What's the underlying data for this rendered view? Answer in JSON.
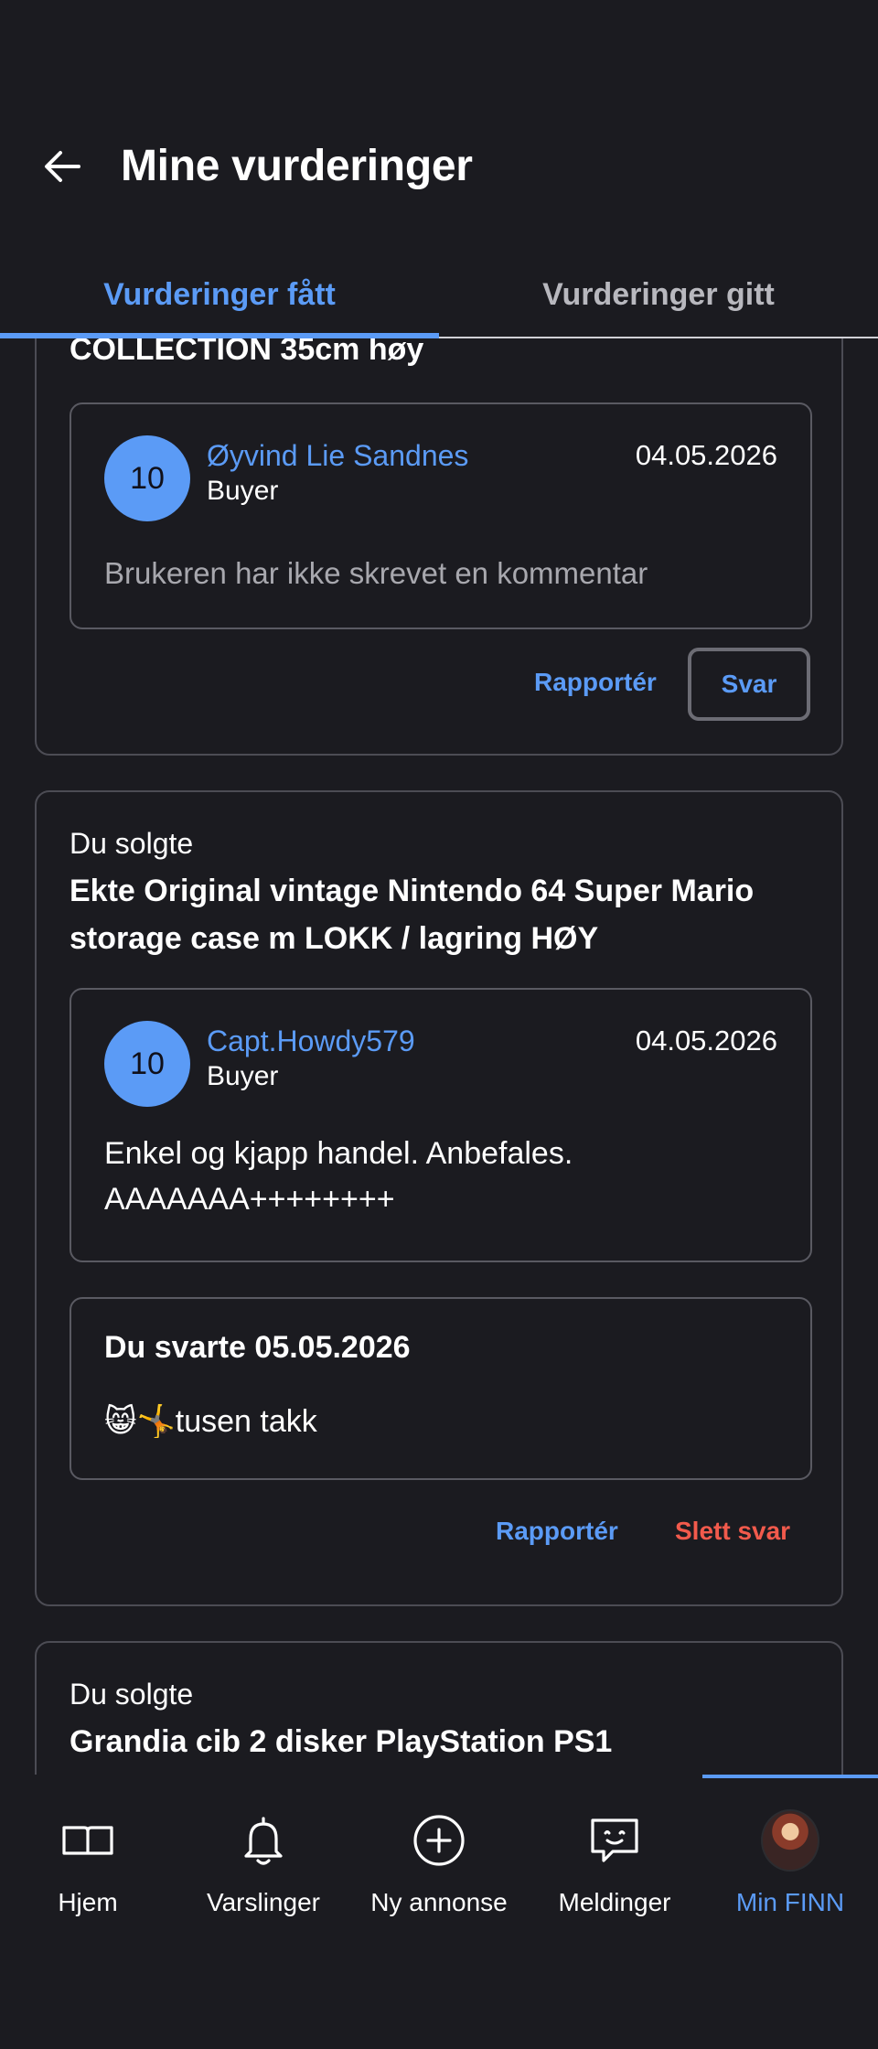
{
  "header": {
    "title": "Mine vurderinger"
  },
  "tabs": [
    {
      "label": "Vurderinger fått",
      "active": true
    },
    {
      "label": "Vurderinger gitt",
      "active": false
    }
  ],
  "reviews": [
    {
      "product_title": "COLLECTION 35cm høy",
      "score": "10",
      "reviewer": "Øyvind Lie Sandnes",
      "role": "Buyer",
      "date": "04.05.2026",
      "comment": "Brukeren har ikke skrevet en kommentar",
      "actions": {
        "report": "Rapportér",
        "reply": "Svar"
      }
    },
    {
      "sold_label": "Du solgte",
      "product_title": "Ekte Original vintage Nintendo 64 Super Mario storage case m LOKK / lagring HØY",
      "score": "10",
      "reviewer": "Capt.Howdy579",
      "role": "Buyer",
      "date": "04.05.2026",
      "comment": "Enkel og kjapp handel. Anbefales. AAAAAAA++++++++",
      "reply": {
        "title": "Du svarte 05.05.2026",
        "text": "😸🤸tusen takk"
      },
      "actions": {
        "report": "Rapportér",
        "delete_reply": "Slett svar"
      }
    },
    {
      "sold_label": "Du solgte",
      "product_title": "Grandia cib 2 disker PlayStation PS1"
    }
  ],
  "bottom_nav": [
    {
      "label": "Hjem",
      "icon": "book-icon"
    },
    {
      "label": "Varslinger",
      "icon": "bell-icon"
    },
    {
      "label": "Ny annonse",
      "icon": "plus-circle-icon"
    },
    {
      "label": "Meldinger",
      "icon": "chat-icon"
    },
    {
      "label": "Min FINN",
      "icon": "profile-avatar",
      "active": true
    }
  ],
  "colors": {
    "background": "#1b1b20",
    "accent": "#5b9bf6",
    "danger": "#f25a4c",
    "border": "#4c4c54"
  }
}
